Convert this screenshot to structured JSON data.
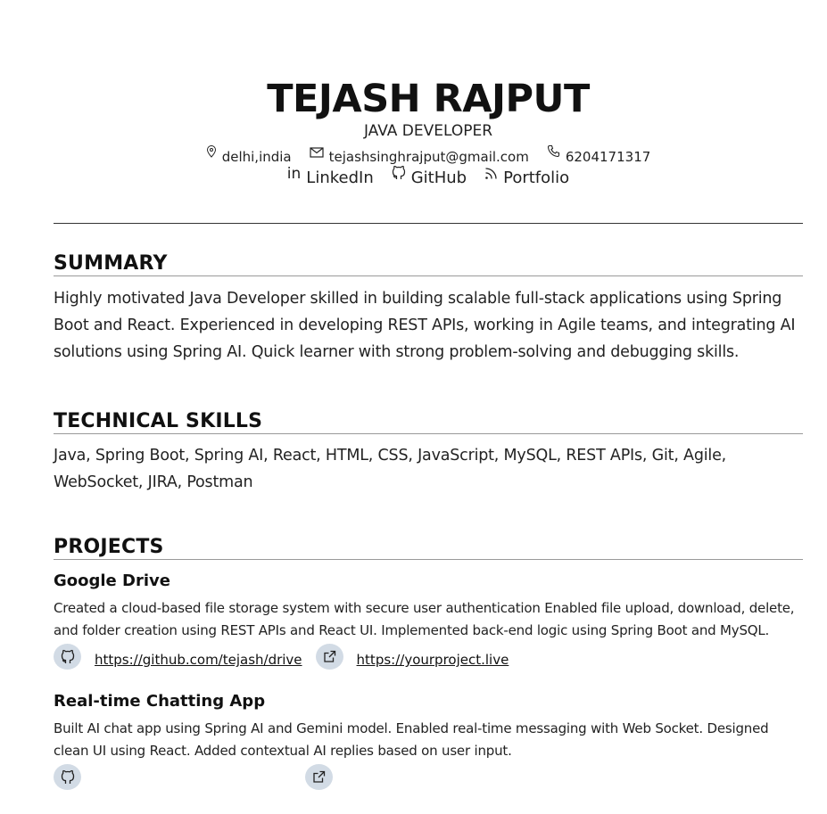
{
  "header": {
    "name": "TEJASH RAJPUT",
    "role": "JAVA DEVELOPER",
    "location": "delhi,india",
    "email": "tejashsinghrajput@gmail.com",
    "phone": "6204171317",
    "linkedin_label": "LinkedIn",
    "github_label": "GitHub",
    "portfolio_label": "Portfolio"
  },
  "summary": {
    "title": "SUMMARY",
    "text": "Highly motivated Java Developer skilled in building scalable full-stack applications using Spring Boot and React. Experienced in developing REST APIs, working in Agile teams, and integrating AI solutions using Spring AI. Quick learner with strong problem-solving and debugging skills."
  },
  "skills": {
    "title": "TECHNICAL SKILLS",
    "text": "Java, Spring Boot, Spring AI, React, HTML, CSS, JavaScript, MySQL, REST APIs, Git, Agile, WebSocket, JIRA, Postman"
  },
  "projects": {
    "title": "PROJECTS",
    "items": [
      {
        "title": "Google Drive",
        "desc": "Created a cloud-based file storage system with secure user authentication Enabled file upload, download, delete, and folder creation using REST APIs and React UI. Implemented back-end logic using Spring Boot and MySQL.",
        "github_link": "https://github.com/tejash/drive",
        "live_link": "https://yourproject.live"
      },
      {
        "title": "Real-time Chatting App",
        "desc": "Built AI chat app using Spring AI and Gemini model. Enabled real-time messaging with Web Socket. Designed clean UI using React. Added contextual AI replies based on user input."
      }
    ]
  },
  "icons": {
    "location": "location-pin-icon",
    "email": "mail-icon",
    "phone": "phone-icon",
    "linkedin": "linkedin-icon",
    "github": "github-icon",
    "portfolio": "rss-icon",
    "external": "external-link-icon"
  },
  "colors": {
    "text": "#111111",
    "icon_bubble": "#d2dbe5",
    "rule": "#999999"
  }
}
